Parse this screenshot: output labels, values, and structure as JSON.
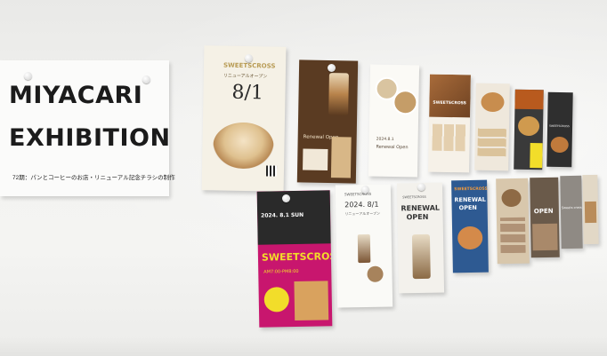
{
  "sign": {
    "line1": "MIYACARI",
    "line2": "EXHIBITION",
    "subtitle": "72期：パンとコーヒーのお店・リニューアル記念チラシの制作"
  },
  "posters": {
    "p1": {
      "brand": "SWEETSCROSS",
      "jp": "リニューアルオープン",
      "date": "8/1"
    },
    "p2": {
      "line": "Renewal Open"
    },
    "p3": {
      "date": "2024.8.1",
      "line": "Renewal Open"
    },
    "p4": {
      "brand": "SWEETSCROSS"
    },
    "p7": {
      "brand": "SWEETSCROSS"
    },
    "p8": {
      "line": "OPEN"
    },
    "p9": {
      "date": "2024. 8.1 SUN",
      "brand": "SWEETSCROSS",
      "hours": "AM7:00-PM8:00"
    },
    "p10": {
      "brand": "SWEETSCROSS",
      "date": "2024. 8/1",
      "jp": "リニューアルオープン"
    },
    "p11": {
      "brand": "SWEETSCROSS",
      "l1": "RENEWAL",
      "l2": "OPEN"
    },
    "p12": {
      "brand": "SWEETSCROSS",
      "l1": "RENEWAL",
      "l2": "OPEN"
    },
    "p14": {
      "line": "OPEN"
    },
    "p15": {
      "line": "Sweets cross"
    }
  },
  "colors": {
    "wall": "#f2f2f0",
    "sign_text": "#1b1b1b",
    "yellow": "#f2dd2a",
    "magenta": "#c8166e",
    "blue": "#2e5a92"
  }
}
